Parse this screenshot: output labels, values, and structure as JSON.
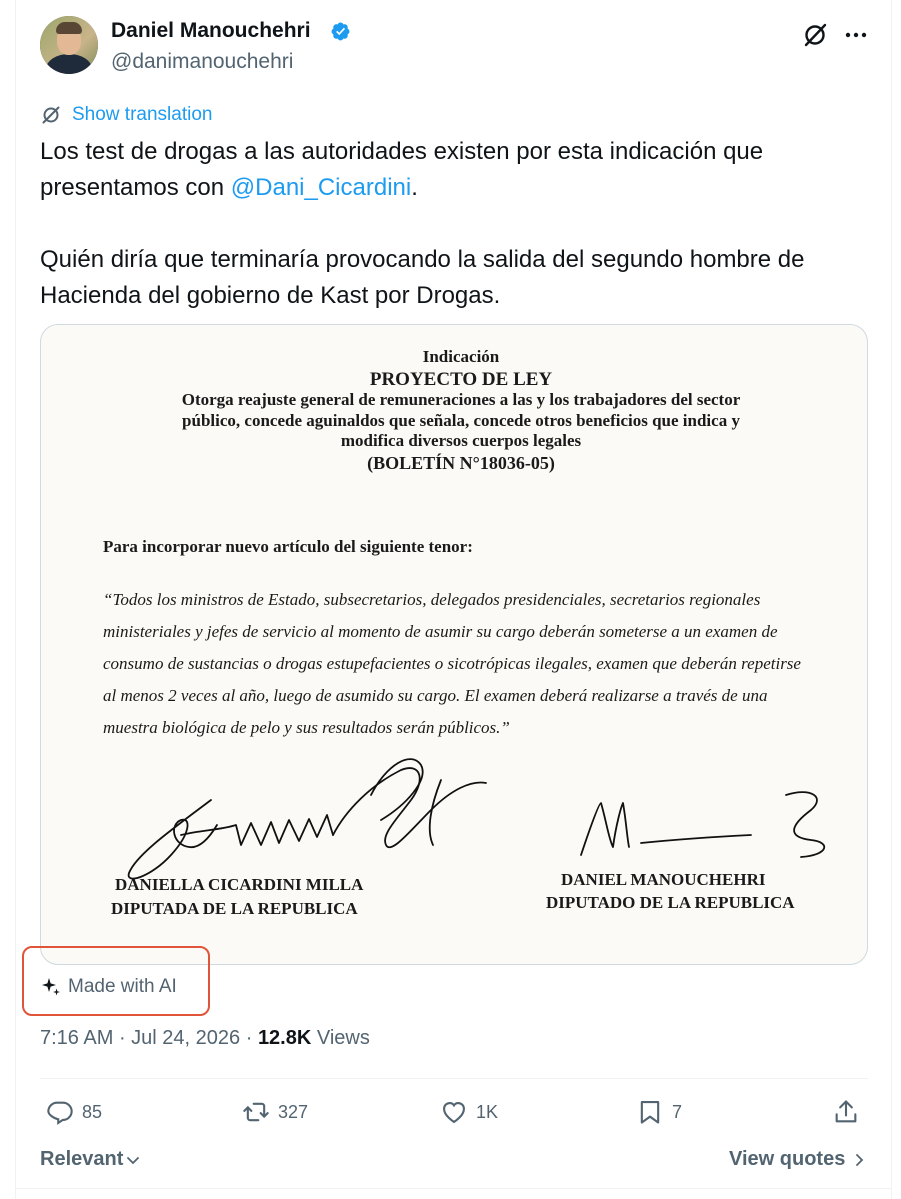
{
  "author": {
    "display_name": "Daniel Manouchehri",
    "handle": "@danimanouchehri",
    "verified": true
  },
  "translate": {
    "label": "Show translation"
  },
  "tweet": {
    "line1": "Los test de drogas a las autoridades existen por esta indicación que",
    "line2_prefix": "presentamos con ",
    "mention": "@Dani_Cicardini",
    "line2_suffix": ".",
    "line3": "Quién diría que terminaría provocando la salida del segundo hombre de",
    "line4": "Hacienda del gobierno de Kast por Drogas."
  },
  "document": {
    "header1": "Indicación",
    "header2": "PROYECTO DE LEY",
    "header3": "Otorga reajuste general de remuneraciones a las y los trabajadores del sector",
    "header4": "público, concede aguinaldos que señala, concede otros beneficios que indica y",
    "header5": "modifica diversos cuerpos legales",
    "header6": "(BOLETÍN N°18036-05)",
    "para_label": "Para incorporar nuevo artículo del siguiente tenor:",
    "quote1": "“Todos los ministros de Estado, subsecretarios, delegados presidenciales, secretarios regionales",
    "quote2": "ministeriales y jefes de servicio al momento de asumir su cargo deberán someterse a un examen de",
    "quote3": "consumo de sustancias o drogas estupefacientes o sicotrópicas ilegales, examen que deberán repetirse",
    "quote4": "al menos 2 veces al año, luego de asumido su cargo. El examen deberá realizarse a través de una",
    "quote5": "muestra biológica de pelo y sus resultados serán públicos.”",
    "signer1_name": "DANIELLA CICARDINI MILLA",
    "signer1_title": "DIPUTADA DE LA REPUBLICA",
    "signer2_name": "DANIEL MANOUCHEHRI",
    "signer2_title": "DIPUTADO DE LA REPUBLICA"
  },
  "ai_label": "Made with AI",
  "meta": {
    "time": "7:16 AM",
    "date": "Jul 24, 2026",
    "views_count": "12.8K",
    "views_label": "Views"
  },
  "actions": {
    "replies": "85",
    "reposts": "327",
    "likes": "1K",
    "bookmarks": "7"
  },
  "footer": {
    "sort_label": "Relevant",
    "view_quotes": "View quotes"
  },
  "colors": {
    "accent": "#1d9bf0",
    "muted": "#536471",
    "highlight_box": "#e0553a"
  }
}
